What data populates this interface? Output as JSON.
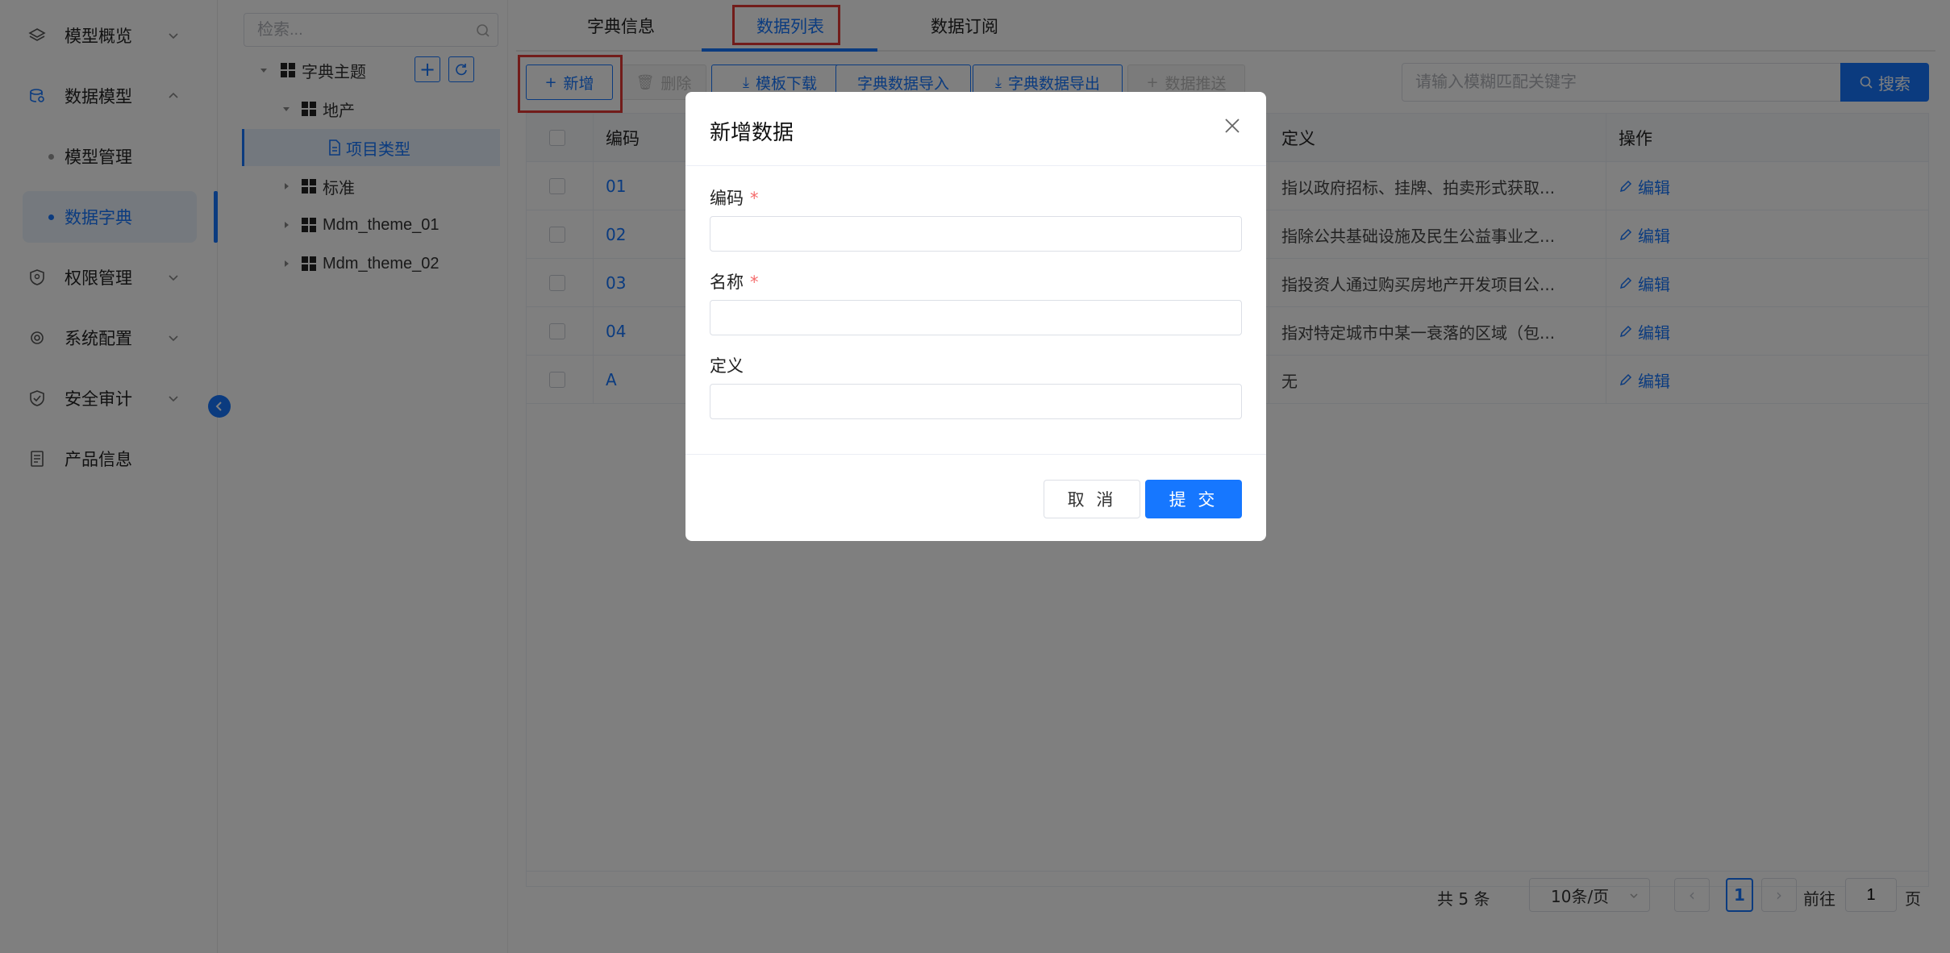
{
  "sidebar": {
    "menu": [
      {
        "label": "模型概览",
        "icon": "layers-icon"
      },
      {
        "label": "数据模型",
        "icon": "database-icon"
      },
      {
        "label": "权限管理",
        "icon": "shield-icon"
      },
      {
        "label": "系统配置",
        "icon": "gear-icon"
      },
      {
        "label": "安全审计",
        "icon": "audit-shield-icon"
      },
      {
        "label": "产品信息",
        "icon": "document-icon"
      }
    ],
    "sub_items": [
      {
        "label": "模型管理"
      },
      {
        "label": "数据字典"
      }
    ]
  },
  "tree": {
    "search_placeholder": "检索...",
    "nodes": [
      {
        "label": "字典主题"
      },
      {
        "label": "地产"
      },
      {
        "label": "项目类型"
      },
      {
        "label": "标准"
      },
      {
        "label": "Mdm_theme_01"
      },
      {
        "label": "Mdm_theme_02"
      }
    ],
    "add_label": "+",
    "refresh_label": "⟳"
  },
  "tabs": [
    {
      "label": "字典信息"
    },
    {
      "label": "数据列表"
    },
    {
      "label": "数据订阅"
    }
  ],
  "toolbar": {
    "add": "新增",
    "delete": "删除",
    "template_download": "模板下载",
    "import": "字典数据导入",
    "export": "字典数据导出",
    "push": "数据推送",
    "search_placeholder": "请输入模糊匹配关键字",
    "search": "搜索"
  },
  "table": {
    "headers": {
      "code": "编码",
      "definition": "定义",
      "action": "操作"
    },
    "rows": [
      {
        "code": "01",
        "definition": "指以政府招标、挂牌、拍卖形式获取...",
        "action": "编辑"
      },
      {
        "code": "02",
        "definition": "指除公共基础设施及民生公益事业之...",
        "action": "编辑"
      },
      {
        "code": "03",
        "definition": "指投资人通过购买房地产开发项目公...",
        "action": "编辑"
      },
      {
        "code": "04",
        "definition": "指对特定城市中某一衰落的区域（包...",
        "action": "编辑"
      },
      {
        "code": "A",
        "definition": "无",
        "action": "编辑"
      }
    ]
  },
  "pager": {
    "total": "共 5 条",
    "page_size": "10条/页",
    "current": "1",
    "goto_label": "前往",
    "goto_value": "1",
    "unit": "页"
  },
  "modal": {
    "title": "新增数据",
    "fields": {
      "code": {
        "label": "编码",
        "required": "*",
        "value": ""
      },
      "name": {
        "label": "名称",
        "required": "*",
        "value": ""
      },
      "definition": {
        "label": "定义",
        "value": ""
      }
    },
    "cancel": "取 消",
    "submit": "提 交"
  },
  "colors": {
    "primary": "#1677ff",
    "highlight": "#e53935",
    "required": "#f56c6c"
  }
}
